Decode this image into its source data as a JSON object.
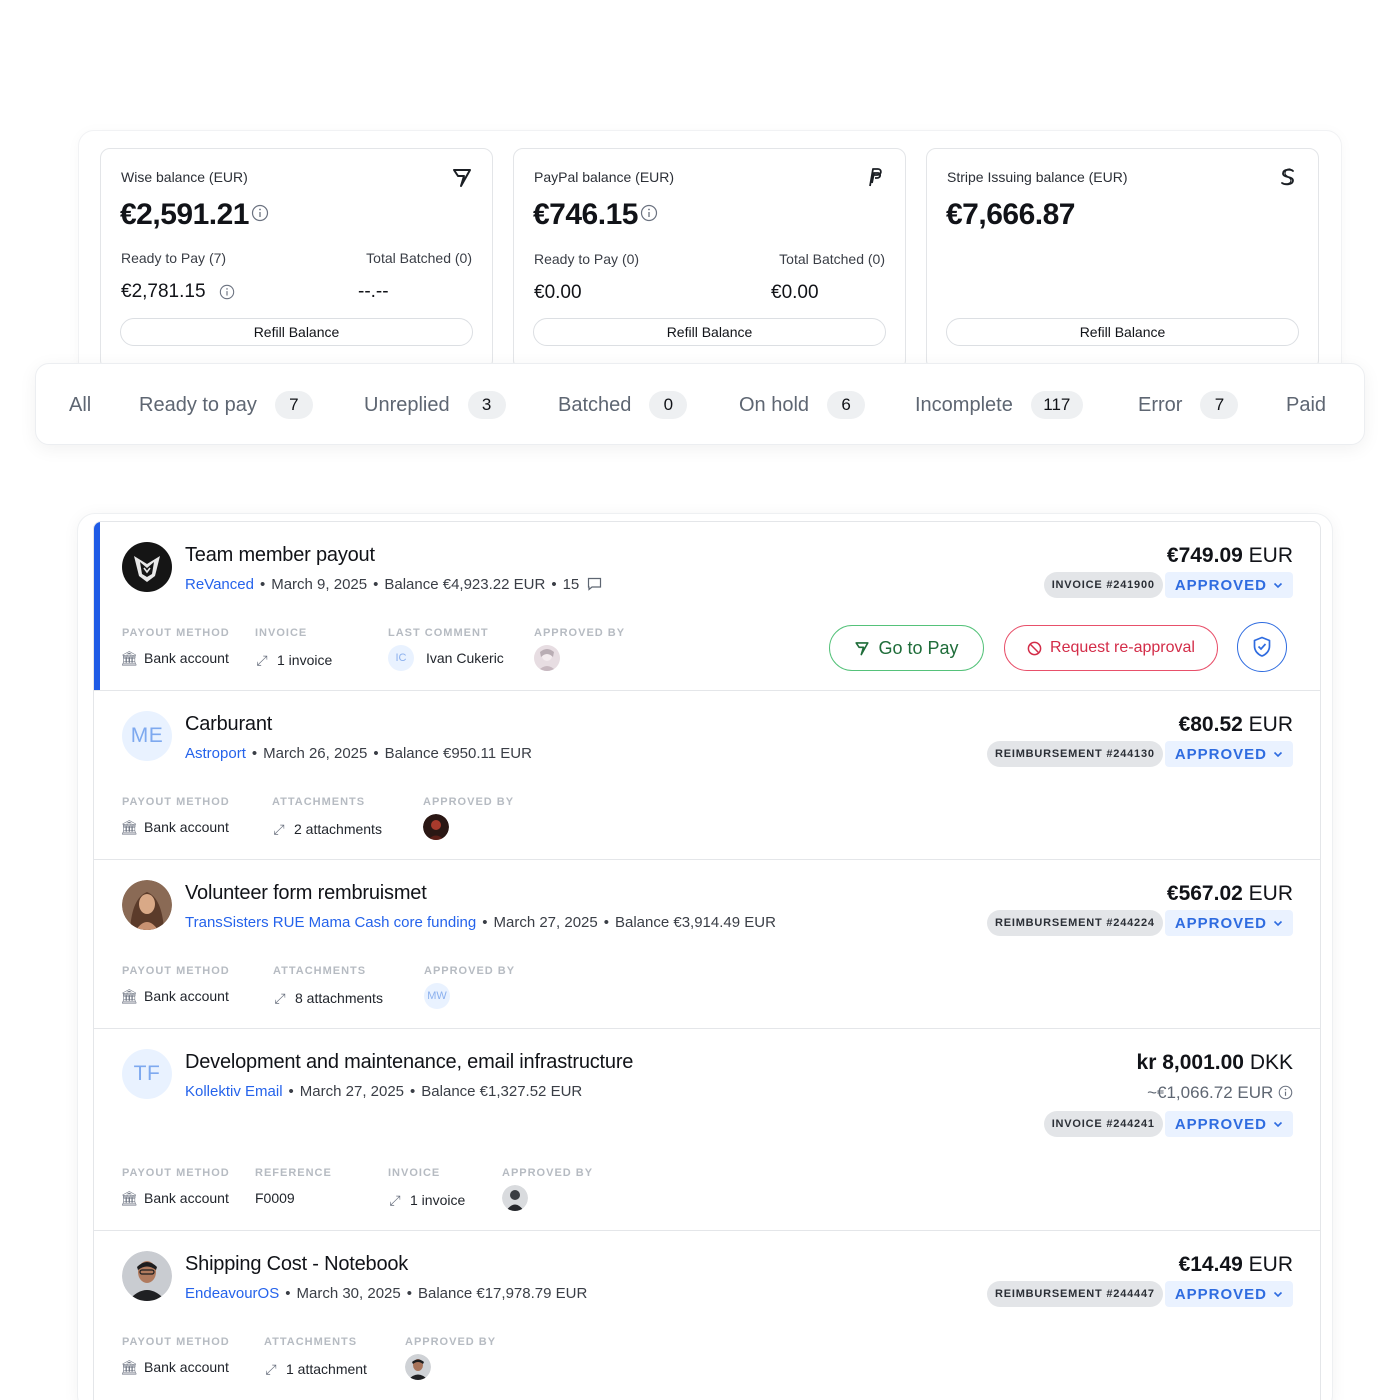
{
  "balances": [
    {
      "title": "Wise balance (EUR)",
      "icon": "wise-logo-icon",
      "amount": "€2,591.21",
      "ready_label": "Ready to Pay (7)",
      "ready_value": "€2,781.15",
      "batched_label": "Total Batched (0)",
      "batched_value": "--.--",
      "refill_label": "Refill Balance"
    },
    {
      "title": "PayPal balance (EUR)",
      "icon": "paypal-logo-icon",
      "amount": "€746.15",
      "ready_label": "Ready to Pay (0)",
      "ready_value": "€0.00",
      "batched_label": "Total Batched (0)",
      "batched_value": "€0.00",
      "refill_label": "Refill Balance"
    },
    {
      "title": "Stripe Issuing balance (EUR)",
      "icon": "stripe-logo-icon",
      "amount": "€7,666.87",
      "refill_label": "Refill Balance"
    }
  ],
  "tabs": [
    {
      "label": "All"
    },
    {
      "label": "Ready to pay",
      "count": "7"
    },
    {
      "label": "Unreplied",
      "count": "3"
    },
    {
      "label": "Batched",
      "count": "0"
    },
    {
      "label": "On hold",
      "count": "6"
    },
    {
      "label": "Incomplete",
      "count": "117"
    },
    {
      "label": "Error",
      "count": "7"
    },
    {
      "label": "Paid"
    }
  ],
  "expenses": [
    {
      "title": "Team member payout",
      "collective": "ReVanced",
      "date": "March 9, 2025",
      "balance": "Balance €4,923.22 EUR",
      "comments": "15",
      "amount": "€749.09",
      "currency": "EUR",
      "type_badge": "INVOICE #241900",
      "status": "APPROVED",
      "fields": {
        "payout_label": "PAYOUT METHOD",
        "payout_value": "Bank account",
        "invoice_label": "INVOICE",
        "invoice_value": "1 invoice",
        "comment_label": "LAST COMMENT",
        "comment_initials": "IC",
        "comment_author": "Ivan Cukeric",
        "approved_label": "APPROVED BY"
      },
      "actions": {
        "pay": "Go to Pay",
        "reapproval": "Request re-approval"
      }
    },
    {
      "title": "Carburant",
      "initials": "ME",
      "collective": "Astroport",
      "date": "March 26, 2025",
      "balance": "Balance €950.11 EUR",
      "amount": "€80.52",
      "currency": "EUR",
      "type_badge": "REIMBURSEMENT #244130",
      "status": "APPROVED",
      "fields": {
        "payout_label": "PAYOUT METHOD",
        "payout_value": "Bank account",
        "attach_label": "ATTACHMENTS",
        "attach_value": "2 attachments",
        "approved_label": "APPROVED BY"
      }
    },
    {
      "title": "Volunteer form rembruismet",
      "collective": "TransSisters RUE Mama Cash core funding",
      "date": "March 27, 2025",
      "balance": "Balance €3,914.49 EUR",
      "amount": "€567.02",
      "currency": "EUR",
      "type_badge": "REIMBURSEMENT #244224",
      "status": "APPROVED",
      "fields": {
        "payout_label": "PAYOUT METHOD",
        "payout_value": "Bank account",
        "attach_label": "ATTACHMENTS",
        "attach_value": "8 attachments",
        "approved_label": "APPROVED BY",
        "approver_initials": "MW"
      }
    },
    {
      "title": "Development and maintenance, email infrastructure",
      "initials": "TF",
      "collective": "Kollektiv Email",
      "date": "March 27, 2025",
      "balance": "Balance €1,327.52 EUR",
      "amount": "kr 8,001.00",
      "currency": "DKK",
      "converted": "~€1,066.72 EUR",
      "type_badge": "INVOICE #244241",
      "status": "APPROVED",
      "fields": {
        "payout_label": "PAYOUT METHOD",
        "payout_value": "Bank account",
        "ref_label": "REFERENCE",
        "ref_value": "F0009",
        "invoice_label": "INVOICE",
        "invoice_value": "1 invoice",
        "approved_label": "APPROVED BY"
      }
    },
    {
      "title": "Shipping Cost - Notebook",
      "collective": "EndeavourOS",
      "date": "March 30, 2025",
      "balance": "Balance €17,978.79 EUR",
      "amount": "€14.49",
      "currency": "EUR",
      "type_badge": "REIMBURSEMENT #244447",
      "status": "APPROVED",
      "fields": {
        "payout_label": "PAYOUT METHOD",
        "payout_value": "Bank account",
        "attach_label": "ATTACHMENTS",
        "attach_value": "1 attachment",
        "approved_label": "APPROVED BY"
      }
    }
  ],
  "colors": {
    "accent": "#2563eb",
    "status_bg": "#eaf2ff",
    "active_bar": "#1f5be6",
    "pay_border": "#55c27a",
    "reapproval": "#d32c48"
  }
}
